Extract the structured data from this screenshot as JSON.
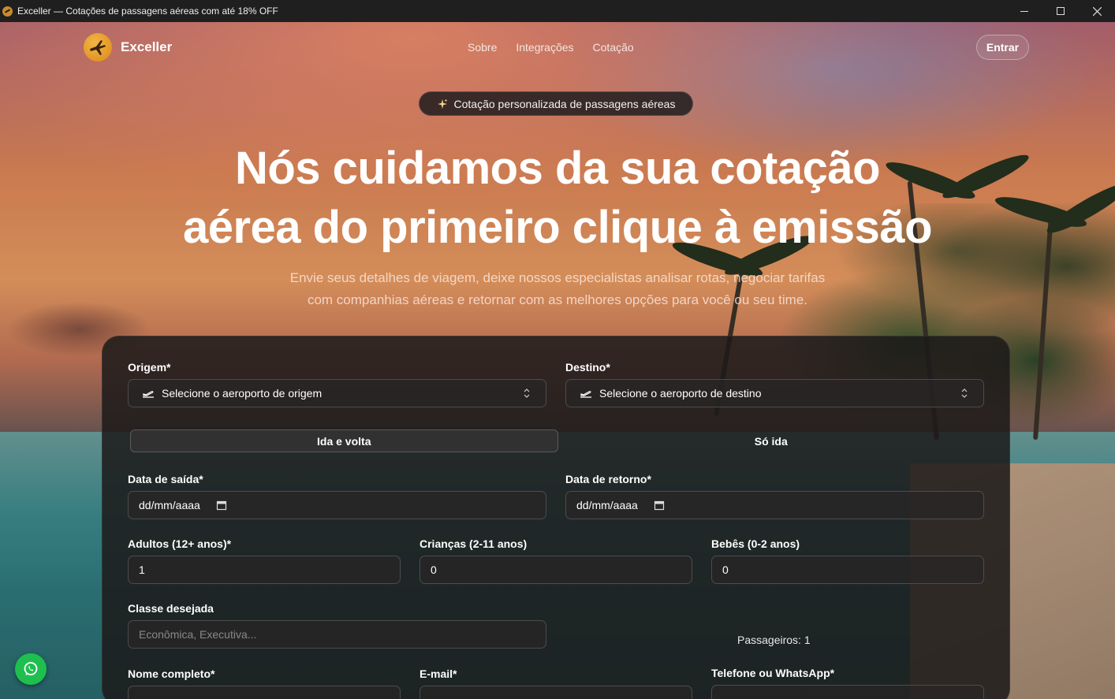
{
  "window": {
    "title": "Exceller — Cotações de passagens aéreas com até 18% OFF"
  },
  "nav": {
    "brand": "Exceller",
    "links": [
      "Sobre",
      "Integrações",
      "Cotação"
    ],
    "login_label": "Entrar"
  },
  "hero": {
    "badge": "Cotação personalizada de passagens aéreas",
    "title_line1": "Nós cuidamos da sua cotação",
    "title_line2": "aérea do primeiro clique à emissão",
    "subtitle_line1": "Envie seus detalhes de viagem, deixe nossos especialistas analisar rotas, negociar tarifas",
    "subtitle_line2": "com companhias aéreas e retornar com as melhores opções para você ou seu time."
  },
  "form": {
    "origin": {
      "label": "Origem*",
      "placeholder": "Selecione o aeroporto de origem"
    },
    "destination": {
      "label": "Destino*",
      "placeholder": "Selecione o aeroporto de destino"
    },
    "trip_type": {
      "options": [
        "Ida e volta",
        "Só ida"
      ],
      "selected": "Ida e volta"
    },
    "departure": {
      "label": "Data de saída*",
      "value": "dd/mm/aaaa"
    },
    "return": {
      "label": "Data de retorno*",
      "value": "dd/mm/aaaa"
    },
    "adults": {
      "label": "Adultos (12+ anos)*",
      "value": "1"
    },
    "children": {
      "label": "Crianças (2-11 anos)",
      "value": "0"
    },
    "infants": {
      "label": "Bebês (0-2 anos)",
      "value": "0"
    },
    "cabin": {
      "label": "Classe desejada",
      "placeholder": "Econômica, Executiva..."
    },
    "passengers_summary": "Passageiros: 1",
    "name": {
      "label": "Nome completo*"
    },
    "email": {
      "label": "E-mail*"
    },
    "phone": {
      "label": "Telefone ou WhatsApp*"
    }
  },
  "colors": {
    "accent": "#f5b544",
    "whatsapp": "#1fbf4f",
    "card_bg": "#1c1a1a"
  },
  "icons": [
    "plane-logo-icon",
    "sparkle-icon",
    "takeoff-icon",
    "chevron-updown-icon",
    "calendar-icon",
    "whatsapp-icon",
    "minimize-icon",
    "maximize-icon",
    "close-icon"
  ]
}
